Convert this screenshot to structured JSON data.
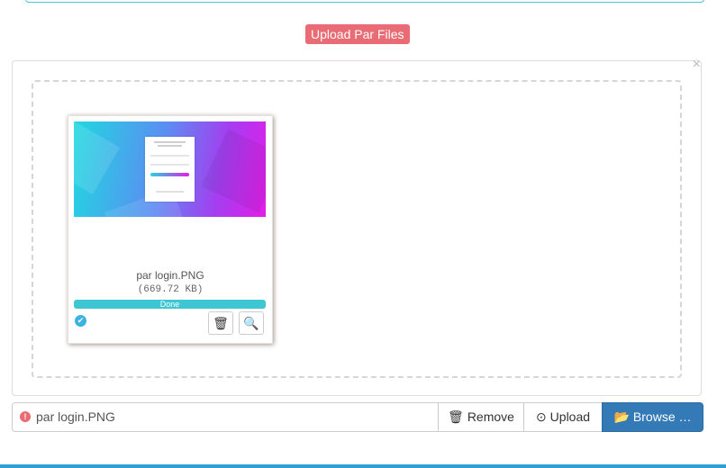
{
  "heading": {
    "upload_badge": "Upload Par Files"
  },
  "dropzone": {
    "close_glyph": "×",
    "file": {
      "name": "par login.PNG",
      "size": "(669.72 KB)",
      "progress_label": "Done",
      "progress_value": 1.0,
      "status_icon": "check-circle-icon",
      "actions": [
        {
          "icon": "trash-icon",
          "glyph": "🗑"
        },
        {
          "icon": "zoom-icon",
          "glyph": "🔍"
        }
      ]
    }
  },
  "footer": {
    "caption_text": "par login.PNG",
    "warning_glyph": "!",
    "remove_label": "Remove",
    "remove_icon": "🗑",
    "upload_label": "Upload",
    "upload_icon": "⊙",
    "browse_label": "Browse …",
    "browse_icon": "📂"
  },
  "colors": {
    "badge": "#e96b73",
    "progress": "#3ec6d3",
    "browse": "#337ab7",
    "accent_rule": "#2f9fd8"
  }
}
